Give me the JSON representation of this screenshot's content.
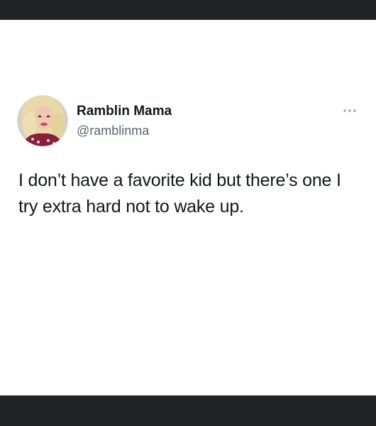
{
  "tweet": {
    "author": {
      "display_name": "Ramblin Mama",
      "handle": "@ramblinma"
    },
    "text": "I don’t have a favorite kid but there’s one I try extra hard not to wake up.",
    "more_icon": "ellipsis-icon"
  },
  "colors": {
    "frame_bar": "#222325",
    "text": "#14171a",
    "secondary_text": "#5b6670"
  }
}
